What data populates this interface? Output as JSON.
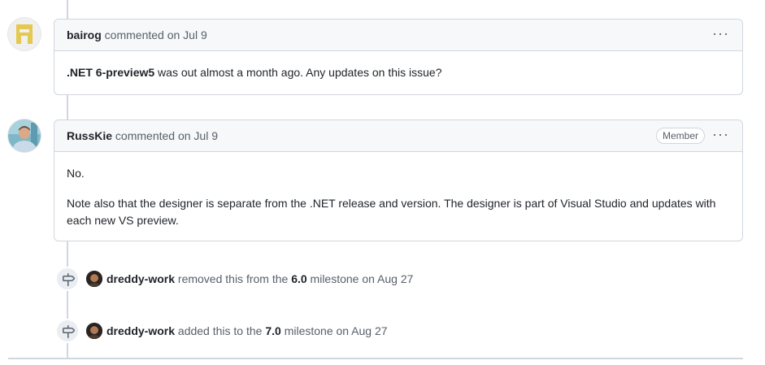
{
  "comments": [
    {
      "author": "bairog",
      "action": "commented",
      "date": "on Jul 9",
      "badge": "",
      "body_bold": ".NET 6-preview5",
      "body_rest": " was out almost a month ago. Any updates on this issue?"
    },
    {
      "author": "RussKie",
      "action": "commented",
      "date": "on Jul 9",
      "badge": "Member",
      "paragraph_1": "No.",
      "paragraph_2": "Note also that the designer is separate from the .NET release and version. The designer is part of Visual Studio and updates with each new VS preview."
    }
  ],
  "more_actions_label": "···",
  "events": [
    {
      "icon": "milestone-icon",
      "actor": "dreddy-work",
      "text_before": "removed this from the",
      "milestone": "6.0",
      "text_after": "milestone on Aug 27"
    },
    {
      "icon": "milestone-icon",
      "actor": "dreddy-work",
      "text_before": "added this to the",
      "milestone": "7.0",
      "text_after": "milestone on Aug 27"
    }
  ],
  "colors": {
    "border": "#d0d7de",
    "header_bg": "#f6f8fa",
    "muted_text": "#57606a",
    "text": "#1f2328",
    "identicon": "#e5c84f"
  }
}
